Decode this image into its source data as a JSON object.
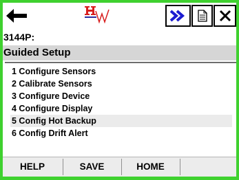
{
  "device_tag": "3144P:",
  "header_title": "Guided Setup",
  "menu": {
    "items": [
      {
        "label": "1 Configure Sensors",
        "selected": false
      },
      {
        "label": "2 Calibrate Sensors",
        "selected": false
      },
      {
        "label": "3 Configure Device",
        "selected": false
      },
      {
        "label": "4 Configure Display",
        "selected": false
      },
      {
        "label": "5 Config Hot Backup",
        "selected": true
      },
      {
        "label": "6 Config Drift Alert",
        "selected": false
      }
    ]
  },
  "footer": {
    "help_label": "HELP",
    "save_label": "SAVE",
    "home_label": "HOME"
  },
  "icons": {
    "back": "back-arrow-icon",
    "logo": "hart-logo",
    "next": "fast-forward-icon",
    "doc": "document-icon",
    "close": "close-icon"
  },
  "colors": {
    "frame_border": "#3fd12f",
    "header_bg": "#d6d6d6",
    "selected_row_bg": "#ebebeb",
    "footer_bg": "#ececec",
    "next_icon": "#1c1cd0",
    "logo_red": "#d81e1e"
  }
}
